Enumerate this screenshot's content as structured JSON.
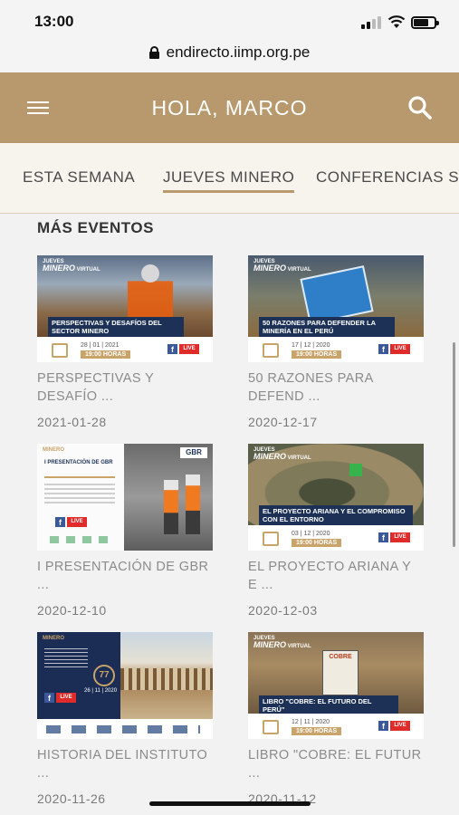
{
  "status_bar": {
    "time": "13:00"
  },
  "browser": {
    "url": "endirecto.iimp.org.pe"
  },
  "header": {
    "title": "HOLA, MARCO"
  },
  "tabs": [
    {
      "label": "ESTA SEMANA",
      "active": false
    },
    {
      "label": "JUEVES MINERO",
      "active": true
    },
    {
      "label": "CONFERENCIAS S",
      "active": false
    }
  ],
  "section": {
    "title": "MÁS EVENTOS"
  },
  "thumb_common": {
    "brand_small": "JUEVES",
    "brand_big": "MINERO",
    "brand_tag": "VIRTUAL",
    "live": "LIVE",
    "hours": "19:00 HORAS",
    "fb": "f"
  },
  "events": [
    {
      "title": "PERSPECTIVAS Y DESAFÍO ...",
      "date": "2021-01-28",
      "thumb_caption": "PERSPECTIVAS Y DESAFÍOS DEL SECTOR MINERO",
      "thumb_date": "28 | 01 | 2021"
    },
    {
      "title": "50 RAZONES PARA DEFEND ...",
      "date": "2020-12-17",
      "thumb_caption": "50 RAZONES PARA DEFENDER LA MINERÍA EN EL PERÚ",
      "thumb_date": "17 | 12 | 2020"
    },
    {
      "title": "I PRESENTACIÓN DE GBR ...",
      "date": "2020-12-10",
      "thumb_caption": "I PRESENTACIÓN DE GBR",
      "thumb_date": "",
      "thumb_brand": "GBR"
    },
    {
      "title": "EL PROYECTO ARIANA Y E ...",
      "date": "2020-12-03",
      "thumb_caption": "EL PROYECTO ARIANA Y EL COMPROMISO CON EL ENTORNO",
      "thumb_date": "03 | 12 | 2020"
    },
    {
      "title": "HISTORIA DEL INSTITUTO ...",
      "date": "2020-11-26",
      "thumb_caption": "",
      "thumb_date": "26 | 11 | 2020",
      "thumb_badge": "77"
    },
    {
      "title": "LIBRO \"COBRE: EL FUTUR ...",
      "date": "2020-11-12",
      "thumb_caption": "LIBRO \"COBRE: EL FUTURO DEL PERÚ\"",
      "thumb_date": "12 | 11 | 2020",
      "thumb_book": "COBRE"
    }
  ]
}
